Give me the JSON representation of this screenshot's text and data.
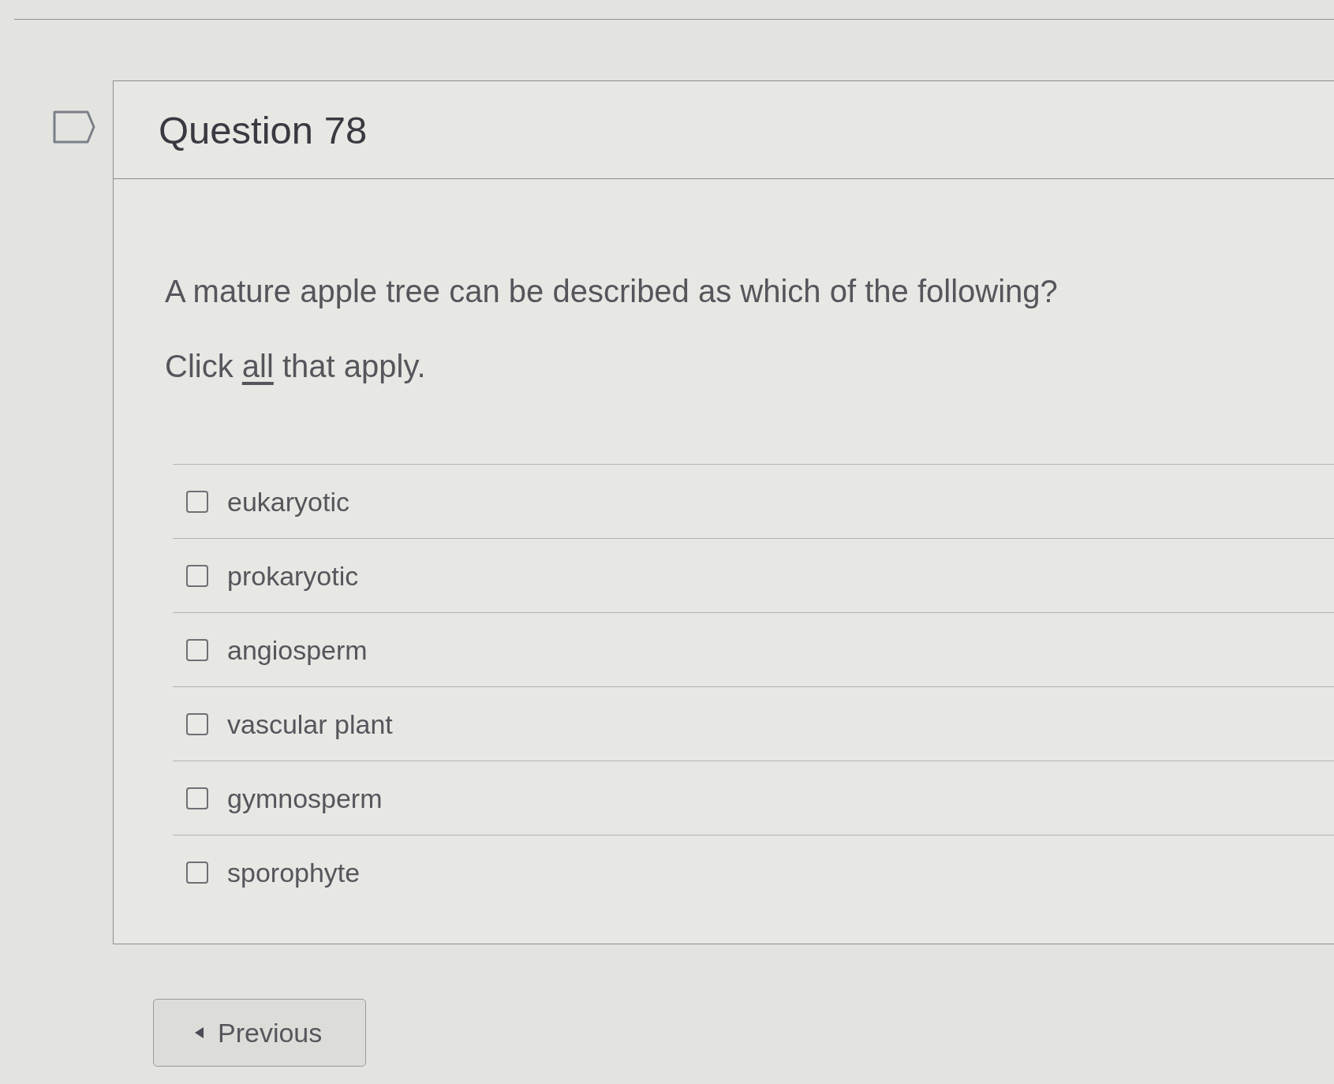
{
  "question": {
    "flagged": false,
    "title": "Question 78",
    "prompt": "A mature apple tree can be described as which of the following?",
    "instruction": {
      "before": "Click ",
      "emphasis": "all",
      "after": " that apply."
    },
    "options": [
      {
        "label": "eukaryotic",
        "checked": false
      },
      {
        "label": "prokaryotic",
        "checked": false
      },
      {
        "label": "angiosperm",
        "checked": false
      },
      {
        "label": "vascular plant",
        "checked": false
      },
      {
        "label": "gymnosperm",
        "checked": false
      },
      {
        "label": "sporophyte",
        "checked": false
      }
    ]
  },
  "navigation": {
    "previous_button": {
      "label": "Previous"
    }
  }
}
